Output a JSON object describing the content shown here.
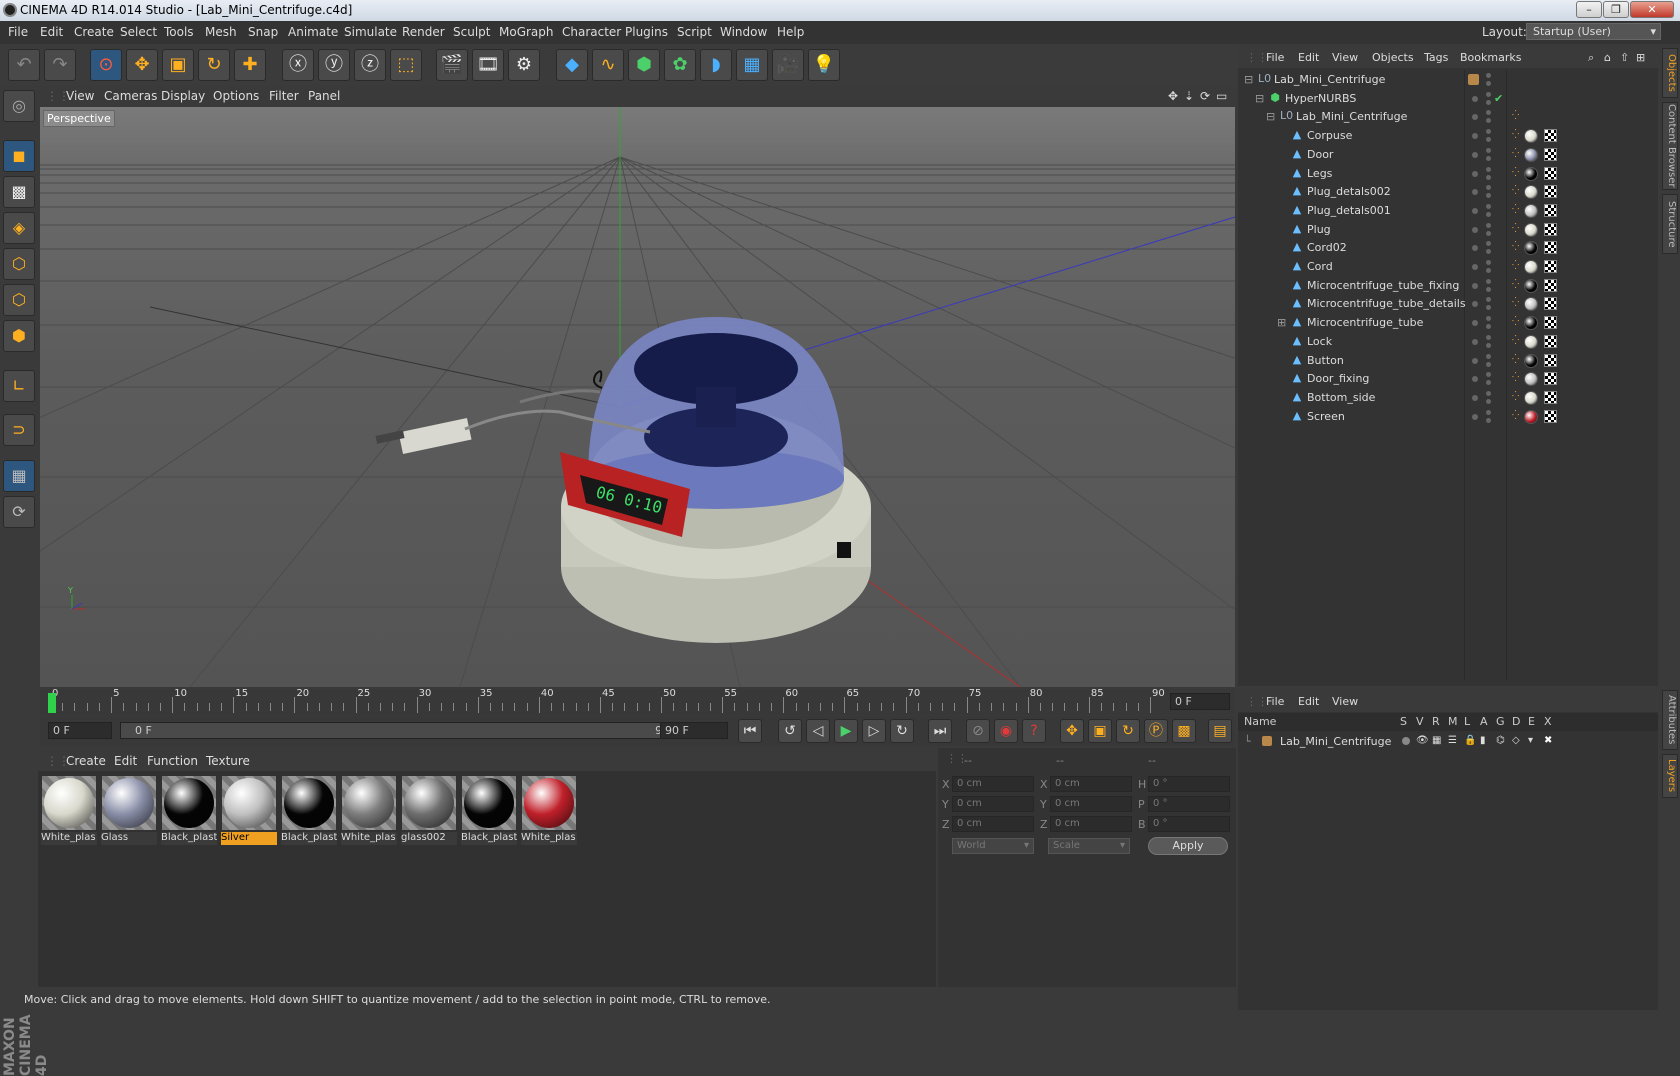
{
  "window": {
    "title": "CINEMA 4D R14.014 Studio - [Lab_Mini_Centrifuge.c4d]"
  },
  "menu": [
    "File",
    "Edit",
    "Create",
    "Select",
    "Tools",
    "Mesh",
    "Snap",
    "Animate",
    "Simulate",
    "Render",
    "Sculpt",
    "MoGraph",
    "Character",
    "Plugins",
    "Script",
    "Window",
    "Help"
  ],
  "layout": {
    "label": "Layout:",
    "value": "Startup (User)"
  },
  "viewport": {
    "menu": [
      "View",
      "Cameras",
      "Display",
      "Options",
      "Filter",
      "Panel"
    ],
    "label": "Perspective"
  },
  "timeline": {
    "ticks": [
      "0",
      "5",
      "10",
      "15",
      "20",
      "25",
      "30",
      "35",
      "40",
      "45",
      "50",
      "55",
      "60",
      "65",
      "70",
      "75",
      "80",
      "85",
      "90"
    ],
    "current_frame": "0 F",
    "start_field": "0 F",
    "range_start": "0 F",
    "range_end": "90 F",
    "end_field": "90 F"
  },
  "materials": {
    "menu": [
      "Create",
      "Edit",
      "Function",
      "Texture"
    ],
    "items": [
      {
        "label": "White_plas",
        "color": "#d8d8cc"
      },
      {
        "label": "Glass",
        "color": "#8a8fa8"
      },
      {
        "label": "Black_plast",
        "color": "#050505"
      },
      {
        "label": "Silver",
        "color": "#c0c0c0"
      },
      {
        "label": "Black_plast",
        "color": "#050505"
      },
      {
        "label": "White_plas",
        "color": "#7d7d7d"
      },
      {
        "label": "glass002",
        "color": "#6e6e6e"
      },
      {
        "label": "Black_plast",
        "color": "#050505"
      },
      {
        "label": "White_plas",
        "color": "#c0202a"
      }
    ]
  },
  "coords": {
    "header": [
      "--",
      "--",
      "--"
    ],
    "rows": [
      {
        "a": "X",
        "av": "0 cm",
        "b": "X",
        "bv": "0 cm",
        "c": "H",
        "cv": "0 °"
      },
      {
        "a": "Y",
        "av": "0 cm",
        "b": "Y",
        "bv": "0 cm",
        "c": "P",
        "cv": "0 °"
      },
      {
        "a": "Z",
        "av": "0 cm",
        "b": "Z",
        "bv": "0 cm",
        "c": "B",
        "cv": "0 °"
      }
    ],
    "space": "World",
    "mode": "Scale",
    "apply": "Apply"
  },
  "objects": {
    "menu": [
      "File",
      "Edit",
      "View",
      "Objects",
      "Tags",
      "Bookmarks"
    ],
    "root": "Lab_Mini_Centrifuge",
    "nurbs": "HyperNURBS",
    "group": "Lab_Mini_Centrifuge",
    "children": [
      "Corpuse",
      "Door",
      "Legs",
      "Plug_detals002",
      "Plug_detals001",
      "Plug",
      "Cord02",
      "Cord",
      "Microcentrifuge_tube_fixing",
      "Microcentrifuge_tube_details",
      "Microcentrifuge_tube",
      "Lock",
      "Button",
      "Door_fixing",
      "Bottom_side",
      "Screen"
    ]
  },
  "layers": {
    "menu": [
      "File",
      "Edit",
      "View"
    ],
    "columns": [
      "Name",
      "S",
      "V",
      "R",
      "M",
      "L",
      "A",
      "G",
      "D",
      "E",
      "X"
    ],
    "row": "Lab_Mini_Centrifuge"
  },
  "side_tabs": [
    "Objects",
    "Content Browser",
    "Structure",
    "Attributes",
    "Layers"
  ],
  "status": "Move: Click and drag to move elements. Hold down SHIFT to quantize movement / add to the selection in point mode, CTRL to remove.",
  "brand": "MAXON CINEMA 4D"
}
